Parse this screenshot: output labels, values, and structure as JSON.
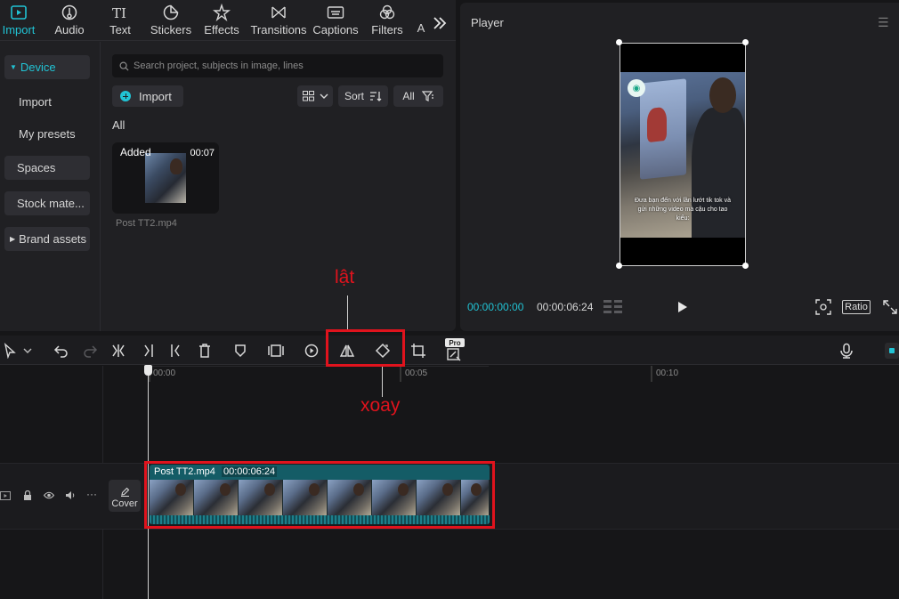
{
  "tabs": [
    {
      "label": "Import",
      "icon": "import-icon",
      "active": true
    },
    {
      "label": "Audio",
      "icon": "audio-icon"
    },
    {
      "label": "Text",
      "icon": "text-icon"
    },
    {
      "label": "Stickers",
      "icon": "stickers-icon"
    },
    {
      "label": "Effects",
      "icon": "effects-icon"
    },
    {
      "label": "Transitions",
      "icon": "transitions-icon"
    },
    {
      "label": "Captions",
      "icon": "captions-icon"
    },
    {
      "label": "Filters",
      "icon": "filters-icon"
    },
    {
      "label": "A",
      "icon": "adjustment-icon"
    }
  ],
  "sidebar": {
    "items": [
      {
        "label": "Device",
        "active": true
      },
      {
        "label": "Import"
      },
      {
        "label": "My presets"
      },
      {
        "label": "Spaces"
      },
      {
        "label": "Stock mate..."
      },
      {
        "label": "Brand assets"
      }
    ]
  },
  "media": {
    "search_placeholder": "Search project, subjects in image, lines",
    "import_label": "Import",
    "sort_label": "Sort",
    "filter_label": "All",
    "section_label": "All",
    "card": {
      "status": "Added",
      "duration": "00:07",
      "name": "Post TT2.mp4"
    }
  },
  "player": {
    "title": "Player",
    "video_caption": "Đưa bạn đến với lần lướt tik tok và gửi những video mà cậu cho tao kiểu:",
    "current_time": "00:00:00:00",
    "total_time": "00:00:06:24",
    "ratio_label": "Ratio"
  },
  "toolbar": {
    "pro_badge": "Pro"
  },
  "timeline": {
    "ticks": [
      "00:00",
      "00:05",
      "00:10"
    ],
    "cover_label": "Cover",
    "clip": {
      "name": "Post TT2.mp4",
      "duration": "00:00:06:24"
    }
  },
  "annotations": {
    "flip_label": "lật",
    "rotate_label": "xoay"
  },
  "colors": {
    "accent": "#21c3d4",
    "annotation": "#e0131d",
    "clip": "#145c66"
  }
}
